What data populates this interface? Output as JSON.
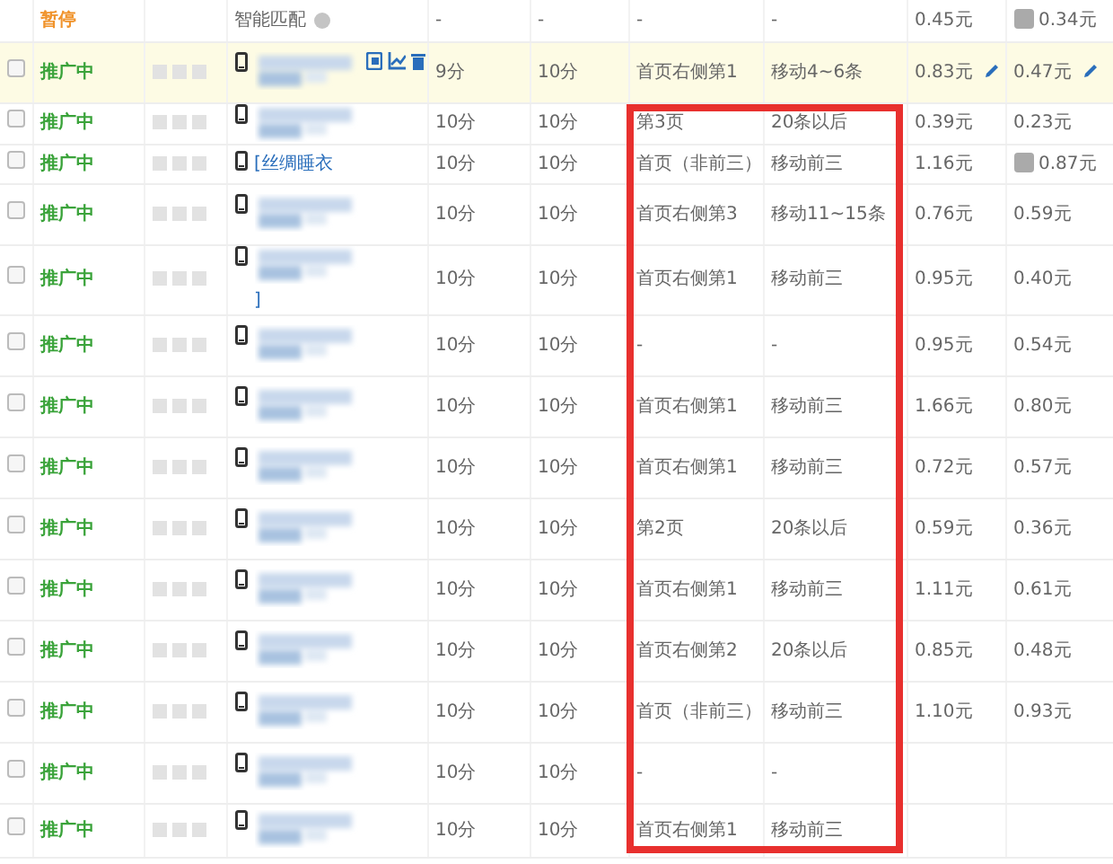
{
  "rows": [
    {
      "kind": "paused",
      "status": "暂停",
      "keyword": "智能匹配",
      "help": true,
      "blurred": false,
      "score_1": "-",
      "score_2": "-",
      "pc_rank": "-",
      "mobile_rank": "-",
      "price_1": "0.45元",
      "price_2": "0.34元",
      "price_2_badge": true
    },
    {
      "kind": "active",
      "checked": false,
      "selected": true,
      "status": "推广中",
      "blurred": true,
      "actions": true,
      "editable": true,
      "score_1": "9分",
      "score_2": "10分",
      "pc_rank": "首页右侧第1",
      "mobile_rank": "移动4~6条",
      "price_1": "0.83元",
      "price_2": "0.47元"
    },
    {
      "kind": "active",
      "checked": false,
      "selected": false,
      "status": "推广中",
      "blurred": true,
      "score_1": "10分",
      "score_2": "10分",
      "pc_rank": "第3页",
      "mobile_rank": "20条以后",
      "price_1": "0.39元",
      "price_2": "0.23元"
    },
    {
      "kind": "active",
      "checked": false,
      "selected": false,
      "status": "推广中",
      "keyword": "[丝绸睡衣",
      "blurred": false,
      "score_1": "10分",
      "score_2": "10分",
      "pc_rank": "首页（非前三）",
      "mobile_rank": "移动前三",
      "price_1": "1.16元",
      "price_2": "0.87元",
      "price_2_badge": true
    },
    {
      "kind": "active",
      "checked": false,
      "selected": false,
      "status": "推广中",
      "blurred": true,
      "score_1": "10分",
      "score_2": "10分",
      "pc_rank": "首页右侧第3",
      "mobile_rank": "移动11~15条",
      "price_1": "0.76元",
      "price_2": "0.59元"
    },
    {
      "kind": "active",
      "checked": false,
      "selected": false,
      "status": "推广中",
      "blurred": true,
      "keyword": "]",
      "score_1": "10分",
      "score_2": "10分",
      "pc_rank": "首页右侧第1",
      "mobile_rank": "移动前三",
      "price_1": "0.95元",
      "price_2": "0.40元"
    },
    {
      "kind": "active",
      "checked": false,
      "selected": false,
      "status": "推广中",
      "blurred": true,
      "score_1": "10分",
      "score_2": "10分",
      "pc_rank": "-",
      "mobile_rank": "-",
      "price_1": "0.95元",
      "price_2": "0.54元"
    },
    {
      "kind": "active",
      "checked": false,
      "selected": false,
      "status": "推广中",
      "blurred": true,
      "score_1": "10分",
      "score_2": "10分",
      "pc_rank": "首页右侧第1",
      "mobile_rank": "移动前三",
      "price_1": "1.66元",
      "price_2": "0.80元"
    },
    {
      "kind": "active",
      "checked": false,
      "selected": false,
      "status": "推广中",
      "blurred": true,
      "score_1": "10分",
      "score_2": "10分",
      "pc_rank": "首页右侧第1",
      "mobile_rank": "移动前三",
      "price_1": "0.72元",
      "price_2": "0.57元"
    },
    {
      "kind": "active",
      "checked": false,
      "selected": false,
      "status": "推广中",
      "blurred": true,
      "score_1": "10分",
      "score_2": "10分",
      "pc_rank": "第2页",
      "mobile_rank": "20条以后",
      "price_1": "0.59元",
      "price_2": "0.36元"
    },
    {
      "kind": "active",
      "checked": false,
      "selected": false,
      "status": "推广中",
      "blurred": true,
      "score_1": "10分",
      "score_2": "10分",
      "pc_rank": "首页右侧第1",
      "mobile_rank": "移动前三",
      "price_1": "1.11元",
      "price_2": "0.61元"
    },
    {
      "kind": "active",
      "checked": false,
      "selected": false,
      "status": "推广中",
      "blurred": true,
      "score_1": "10分",
      "score_2": "10分",
      "pc_rank": "首页右侧第2",
      "mobile_rank": "20条以后",
      "price_1": "0.85元",
      "price_2": "0.48元"
    },
    {
      "kind": "active",
      "checked": false,
      "selected": false,
      "status": "推广中",
      "blurred": true,
      "score_1": "10分",
      "score_2": "10分",
      "pc_rank": "首页（非前三）",
      "mobile_rank": "移动前三",
      "price_1": "1.10元",
      "price_2": "0.93元"
    },
    {
      "kind": "active",
      "checked": false,
      "selected": false,
      "status": "推广中",
      "blurred": true,
      "score_1": "10分",
      "score_2": "10分",
      "pc_rank": "-",
      "mobile_rank": "-"
    },
    {
      "kind": "active",
      "checked": false,
      "selected": false,
      "status": "推广中",
      "blurred": true,
      "score_1": "10分",
      "score_2": "10分",
      "pc_rank": "首页右侧第1",
      "mobile_rank": "移动前三"
    }
  ]
}
